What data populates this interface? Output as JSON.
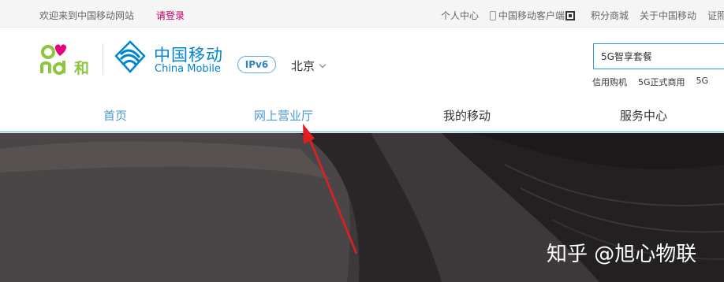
{
  "topbar": {
    "welcome": "欢迎来到中国移动网站",
    "login": "请登录",
    "links": [
      "个人中心",
      "中国移动客户端",
      "积分商城",
      "关于中国移动",
      "证照信"
    ]
  },
  "header": {
    "and_logo_text": "and和",
    "brand_cn": "中国移动",
    "brand_en": "China Mobile",
    "ipv6": "IPv6",
    "city": "北京",
    "search_value": "5G智享套餐",
    "hot_words": [
      "信用购机",
      "5G正式商用",
      "5G"
    ]
  },
  "nav": {
    "items": [
      "首页",
      "网上营业厅",
      "我的移动",
      "服务中心"
    ]
  },
  "banner": {
    "watermark": "知乎 @旭心物联"
  },
  "colors": {
    "brand_blue": "#0085d0",
    "login_pink": "#c3006b",
    "nav_blue": "#4a98d6",
    "annotation_red": "#e02020"
  }
}
